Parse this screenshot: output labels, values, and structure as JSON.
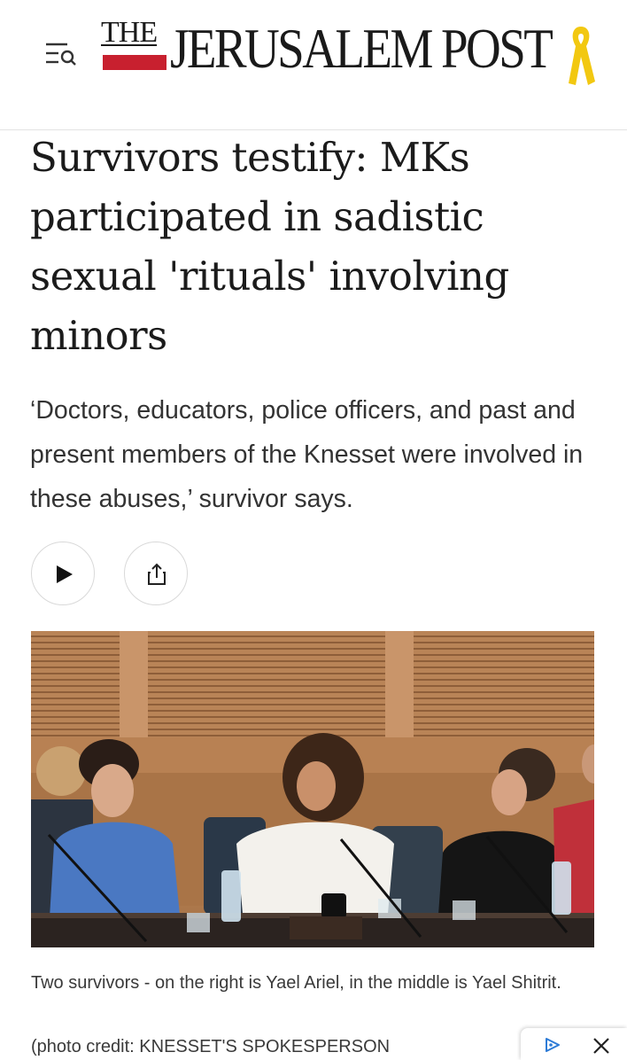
{
  "header": {
    "logo_the": "THE",
    "logo_main": "JERUSALEM POST",
    "brand_color": "#c8202f",
    "ribbon_color": "#f2c811",
    "menu_icon": "menu-search-icon"
  },
  "article": {
    "headline": "Survivors testify: MKs participated in sadistic sexual 'rituals' involving minors",
    "subheadline": "‘Doctors, educators, police officers, and past and present members of the Knesset were involved in these abuses,’ survivor says.",
    "actions": {
      "play_icon": "play-icon",
      "share_icon": "share-icon"
    },
    "photo": {
      "caption": "Two survivors - on the right is Yael Ariel, in the middle is Yael Shitrit.",
      "credit": "(photo credit: KNESSET'S SPOKESPERSON"
    }
  },
  "ad": {
    "choices_icon": "ad-choices-icon",
    "close_icon": "close-icon",
    "accent": "#2d7bd6"
  }
}
